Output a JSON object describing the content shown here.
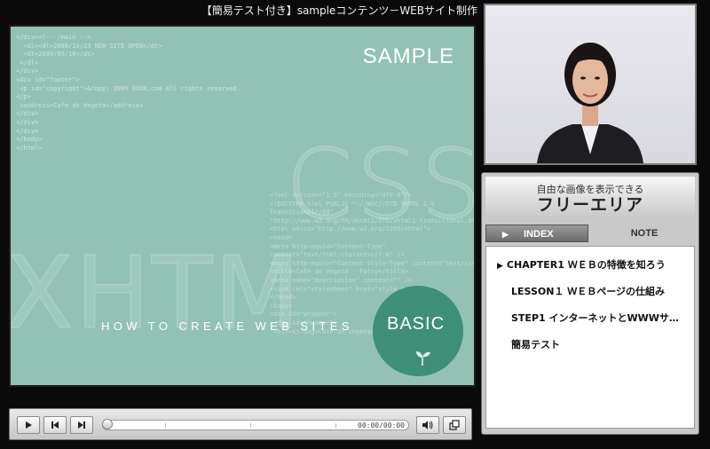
{
  "title": "【簡易テスト付き】sampleコンテンツ－WEBサイト制作",
  "slide": {
    "sample_label": "SAMPLE",
    "tagline": "HOW TO CREATE WEB SITES",
    "basic_label": "BASIC",
    "big_css": "CSS",
    "big_xhtml": "XHTM"
  },
  "player": {
    "time": "00:00/00:00",
    "progress": 0,
    "buttons": [
      "play",
      "previous",
      "next",
      "volume",
      "fullscreen"
    ]
  },
  "free_area": {
    "subtitle": "自由な画像を表示できる",
    "title": "フリーエリア"
  },
  "tabs": {
    "index": "INDEX",
    "note": "NOTE"
  },
  "index_items": [
    {
      "label": "CHAPTER1 ＷＥＢの特徴を知ろう",
      "current": true
    },
    {
      "label": "LESSON１ ＷＥＢページの仕組み",
      "current": false
    },
    {
      "label": "STEP1 インターネットとWWWサ…",
      "current": false
    },
    {
      "label": "簡易テスト",
      "current": false
    }
  ],
  "colors": {
    "slide_bg": "#93c2b5",
    "basic_circle": "#3e8f78",
    "page_bg": "#0a0a0a"
  }
}
